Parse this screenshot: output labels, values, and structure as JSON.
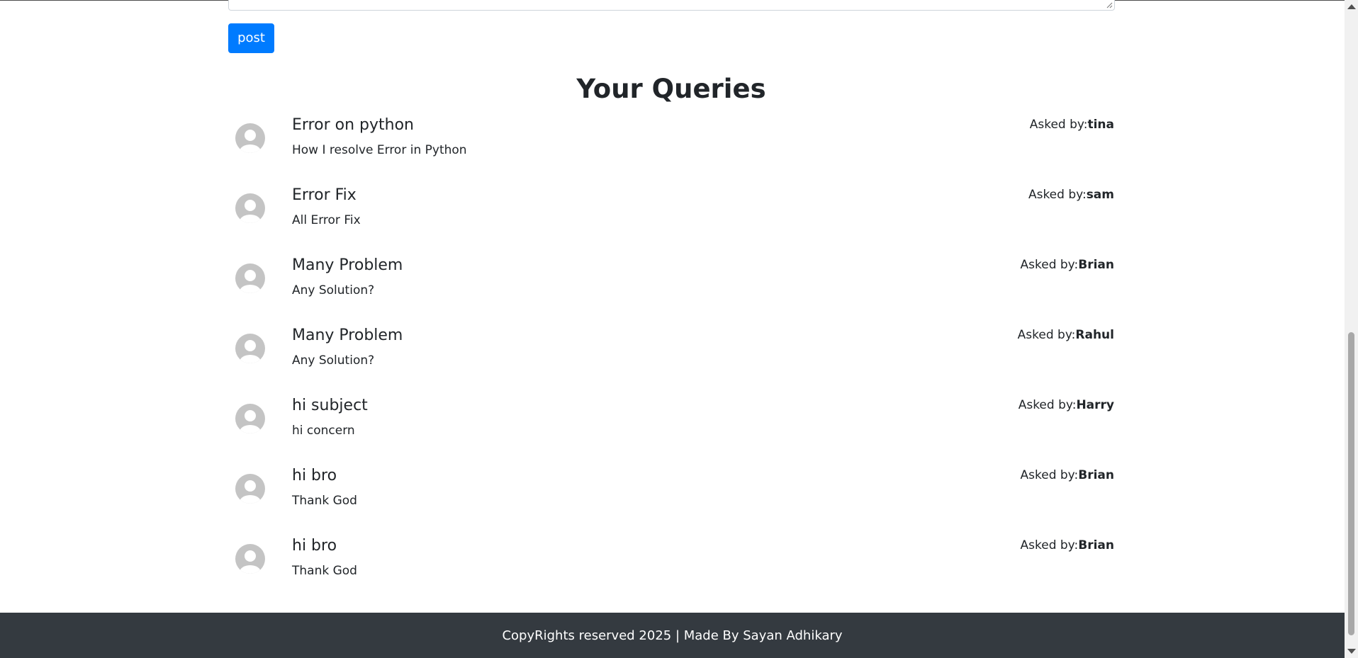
{
  "form": {
    "post_label": "post"
  },
  "queries_heading": "Your Queries",
  "asked_by_prefix": "Asked by:",
  "queries": [
    {
      "title": "Error on python",
      "body": "How I resolve Error in Python",
      "author": "tina"
    },
    {
      "title": "Error Fix",
      "body": "All Error Fix",
      "author": "sam"
    },
    {
      "title": "Many Problem",
      "body": "Any Solution?",
      "author": "Brian"
    },
    {
      "title": "Many Problem",
      "body": "Any Solution?",
      "author": "Rahul"
    },
    {
      "title": "hi subject",
      "body": "hi concern",
      "author": "Harry"
    },
    {
      "title": "hi bro",
      "body": "Thank God",
      "author": "Brian"
    },
    {
      "title": "hi bro",
      "body": "Thank God",
      "author": "Brian"
    }
  ],
  "footer": {
    "text": "CopyRights reserved 2025 | Made By Sayan Adhikary"
  },
  "icons": {
    "avatar": "user-avatar-icon",
    "resize": "resize-grip-icon",
    "scroll_up": "scroll-up-arrow-icon",
    "scroll_down": "scroll-down-arrow-icon"
  },
  "colors": {
    "primary": "#007bff",
    "footer_bg": "#343a40",
    "avatar_bg": "#c4c4c4",
    "avatar_fg": "#ffffff"
  }
}
